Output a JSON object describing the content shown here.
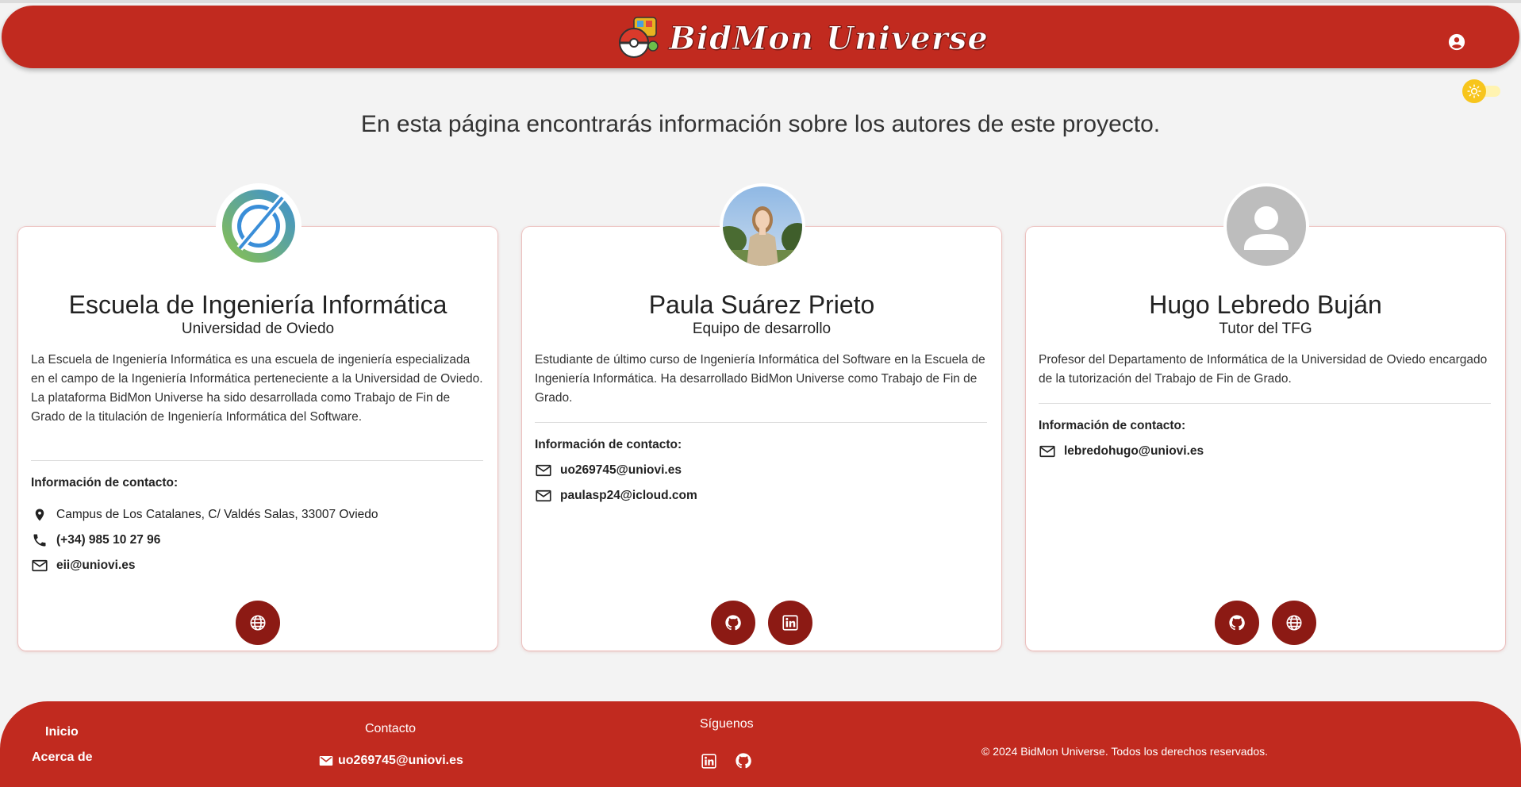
{
  "header": {
    "app_name": "BidMon Universe",
    "logo_icon": "pokeball-logo-icon",
    "account_icon": "account-circle-icon",
    "theme_icon": "sun-icon",
    "theme_toggle_state": "light",
    "brand_color": "#c12a1f"
  },
  "intro": "En esta página encontrarás información sobre los autores de este proyecto.",
  "contact_title": "Información de contacto:",
  "cards": [
    {
      "name": "Escuela de Ingeniería Informática",
      "role": "Universidad de Oviedo",
      "avatar": "school-logo",
      "description": [
        "La Escuela de Ingeniería Informática es una escuela de ingeniería especializada en el campo de la Ingeniería Informática perteneciente a la Universidad de Oviedo.",
        "La plataforma BidMon Universe ha sido desarrollada como Trabajo de Fin de Grado de la titulación de Ingeniería Informática del Software."
      ],
      "contacts": [
        {
          "icon": "location-pin-icon",
          "text": "Campus de Los Catalanes, C/ Valdés Salas, 33007 Oviedo"
        },
        {
          "icon": "phone-icon",
          "text": "(+34) 985 10 27 96"
        },
        {
          "icon": "mail-icon",
          "text": "eii@uniovi.es"
        }
      ],
      "buttons": [
        "globe-icon"
      ]
    },
    {
      "name": "Paula Suárez Prieto",
      "role": "Equipo de desarrollo",
      "avatar": "person-photo",
      "description": [
        "Estudiante de último curso de Ingeniería Informática del Software en la Escuela de Ingeniería Informática. Ha desarrollado BidMon Universe como Trabajo de Fin de Grado."
      ],
      "contacts": [
        {
          "icon": "mail-icon",
          "text": "uo269745@uniovi.es"
        },
        {
          "icon": "mail-icon",
          "text": "paulasp24@icloud.com"
        }
      ],
      "buttons": [
        "github-icon",
        "linkedin-icon"
      ]
    },
    {
      "name": "Hugo Lebredo Buján",
      "role": "Tutor del TFG",
      "avatar": "default-person-avatar",
      "description": [
        "Profesor del Departamento de Informática de la Universidad de Oviedo encargado de la tutorización del Trabajo de Fin de Grado."
      ],
      "contacts": [
        {
          "icon": "mail-icon",
          "text": "lebredohugo@uniovi.es"
        }
      ],
      "buttons": [
        "github-icon",
        "globe-icon"
      ]
    }
  ],
  "footer": {
    "nav": [
      "Inicio",
      "Acerca de"
    ],
    "contact_title": "Contacto",
    "contact_email": "uo269745@uniovi.es",
    "follow_title": "Síguenos",
    "social": [
      "linkedin-icon",
      "github-icon"
    ],
    "copyright": "© 2024 BidMon Universe. Todos los derechos reservados."
  }
}
